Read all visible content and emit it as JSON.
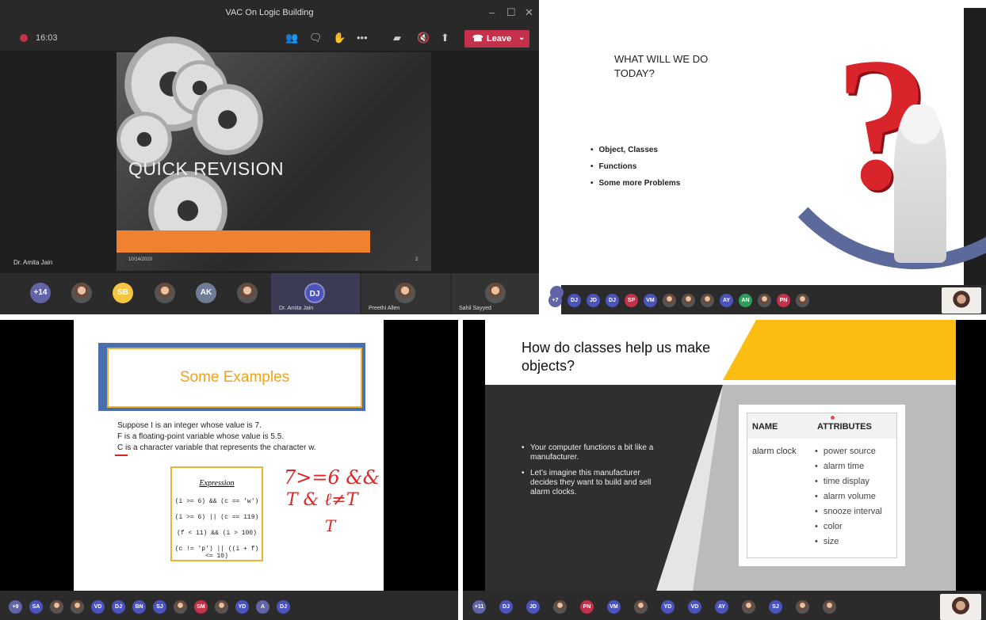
{
  "q1": {
    "window_title": "VAC On Logic Building",
    "window_controls": [
      "–",
      "☐",
      "✕"
    ],
    "timer": "16:03",
    "leave_label": "Leave",
    "slide_title": "QUICK REVISION",
    "slide_date": "10/14/2020",
    "slide_number": "2",
    "speaker_name": "Dr. Amita Jain",
    "more_count": "+14",
    "participants": [
      {
        "initials": "SB",
        "color": "#f5c542"
      },
      {
        "initials": "AK",
        "color": "#6f7c95"
      },
      {
        "initials": "DJ",
        "color": "#4b53bc"
      }
    ],
    "tiles": [
      "Dr. Amita Jain",
      "Preethi Allen",
      "Sahil Sayyed"
    ]
  },
  "q2": {
    "heading": "WHAT WILL WE DO TODAY?",
    "bullets": [
      "Object, Classes",
      "Functions",
      "Some more Problems"
    ],
    "more_count": "+7",
    "participants": [
      {
        "initials": "DJ",
        "color": "#4b53bc"
      },
      {
        "initials": "JD",
        "color": "#4b53bc"
      },
      {
        "initials": "DJ",
        "color": "#4b53bc"
      },
      {
        "initials": "SP",
        "color": "#c4314b"
      },
      {
        "initials": "VM",
        "color": "#4b53bc"
      },
      {
        "initials": "AY",
        "color": "#4b53bc"
      },
      {
        "initials": "AN",
        "color": "#2e9e5b"
      },
      {
        "initials": "PN",
        "color": "#c4314b"
      }
    ]
  },
  "q3": {
    "banner_title": "Some Examples",
    "lines": [
      "Suppose I is an integer whose value is 7.",
      "F is a floating-point variable whose value is 5.5.",
      "C is a character variable that represents the character w."
    ],
    "expression_title": "Expression",
    "expressions": [
      "(i >= 6) && (c == 'w')",
      "(i >= 6) || (c == 119)",
      "(f < 11) && (i > 100)",
      "(c != 'p') || ((i + f) <= 10)"
    ],
    "more_count": "+9",
    "participants": [
      {
        "initials": "SA",
        "color": "#4b53bc"
      },
      {
        "initials": "VD",
        "color": "#4b53bc"
      },
      {
        "initials": "DJ",
        "color": "#4b53bc"
      },
      {
        "initials": "BN",
        "color": "#4b53bc"
      },
      {
        "initials": "SJ",
        "color": "#4b53bc"
      },
      {
        "initials": "SM",
        "color": "#c4314b"
      },
      {
        "initials": "YD",
        "color": "#4b53bc"
      },
      {
        "initials": "A",
        "color": "#6264a7"
      },
      {
        "initials": "DJ",
        "color": "#4b53bc"
      }
    ]
  },
  "q4": {
    "heading": "How do classes help us make objects?",
    "bullets": [
      "Your computer functions a bit like a manufacturer.",
      "Let’s imagine this manufacturer decides they want to build and sell alarm clocks."
    ],
    "table_headers": [
      "NAME",
      "ATTRIBUTES"
    ],
    "table_name": "alarm clock",
    "attributes": [
      "power source",
      "alarm time",
      "time display",
      "alarm volume",
      "snooze interval",
      "color",
      "size"
    ],
    "more_count": "+11",
    "participants": [
      {
        "initials": "DJ",
        "color": "#4b53bc"
      },
      {
        "initials": "JD",
        "color": "#4b53bc"
      },
      {
        "initials": "PN",
        "color": "#c4314b"
      },
      {
        "initials": "VM",
        "color": "#4b53bc"
      },
      {
        "initials": "YD",
        "color": "#4b53bc"
      },
      {
        "initials": "VD",
        "color": "#4b53bc"
      },
      {
        "initials": "AY",
        "color": "#4b53bc"
      },
      {
        "initials": "SJ",
        "color": "#4b53bc"
      }
    ]
  }
}
